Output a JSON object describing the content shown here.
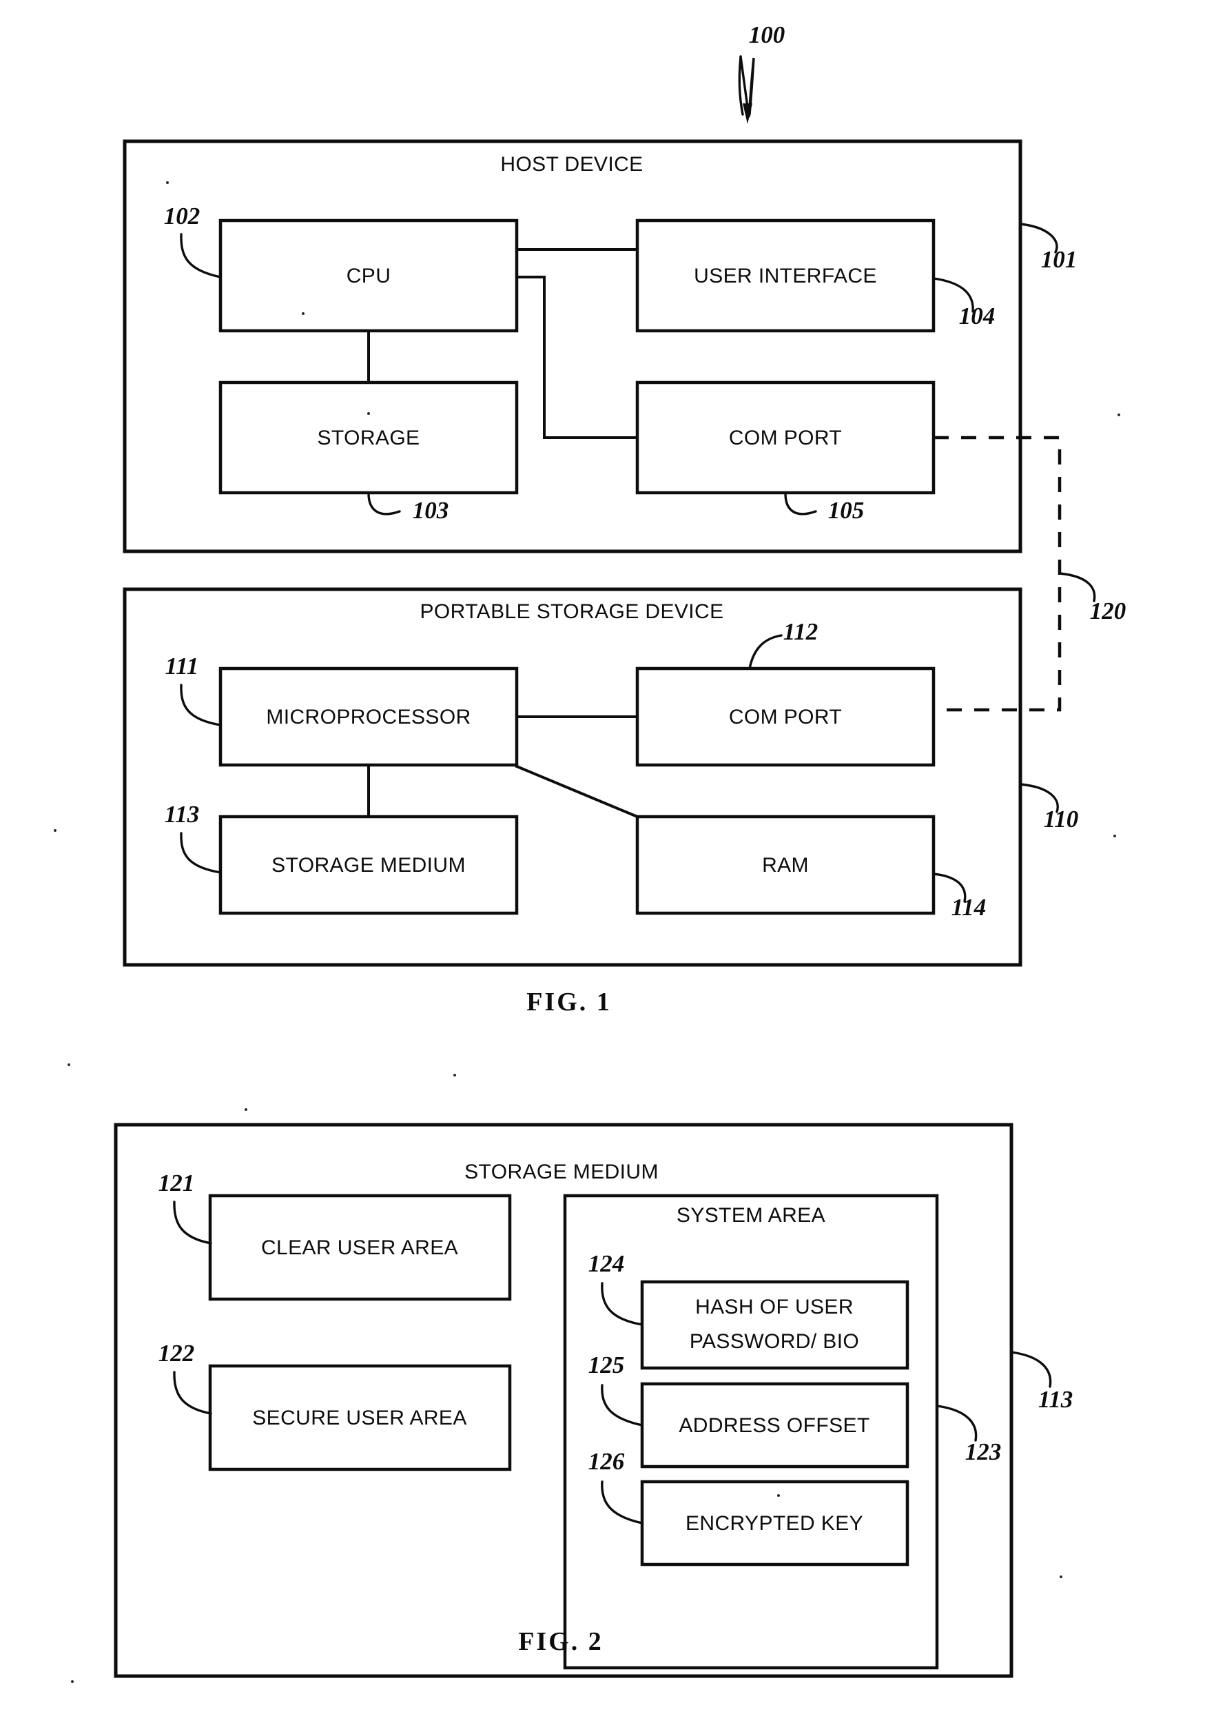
{
  "document": {
    "type": "patent-drawing-sheet",
    "figures": [
      {
        "id": "fig1",
        "caption": "FIG. 1",
        "system_ref": "100",
        "link_ref": "120",
        "containers": [
          {
            "title": "HOST DEVICE",
            "ref": "101",
            "blocks": [
              {
                "label": "CPU",
                "ref": "102"
              },
              {
                "label": "USER INTERFACE",
                "ref": "104"
              },
              {
                "label": "STORAGE",
                "ref": "103"
              },
              {
                "label": "COM PORT",
                "ref": "105"
              }
            ]
          },
          {
            "title": "PORTABLE STORAGE DEVICE",
            "ref": "110",
            "blocks": [
              {
                "label": "MICROPROCESSOR",
                "ref": "111"
              },
              {
                "label": "COM PORT",
                "ref": "112"
              },
              {
                "label": "STORAGE MEDIUM",
                "ref": "113"
              },
              {
                "label": "RAM",
                "ref": "114"
              }
            ]
          }
        ]
      },
      {
        "id": "fig2",
        "caption": "FIG. 2",
        "containers": [
          {
            "title": "STORAGE MEDIUM",
            "ref": "113",
            "blocks": [
              {
                "label": "CLEAR USER AREA",
                "ref": "121"
              },
              {
                "label": "SECURE USER AREA",
                "ref": "122"
              }
            ],
            "subcontainers": [
              {
                "title": "SYSTEM AREA",
                "ref": "123",
                "blocks": [
                  {
                    "label_line1": "HASH OF USER",
                    "label_line2": "PASSWORD/ BIO",
                    "ref": "124"
                  },
                  {
                    "label": "ADDRESS OFFSET",
                    "ref": "125"
                  },
                  {
                    "label": "ENCRYPTED KEY",
                    "ref": "126"
                  }
                ]
              }
            ]
          }
        ]
      }
    ]
  },
  "fig1": {
    "system_ref": "100",
    "link_ref": "120",
    "host": {
      "title": "HOST DEVICE",
      "ref": "101",
      "cpu": {
        "label": "CPU",
        "ref": "102"
      },
      "ui": {
        "label": "USER INTERFACE",
        "ref": "104"
      },
      "storage": {
        "label": "STORAGE",
        "ref": "103"
      },
      "comport": {
        "label": "COM PORT",
        "ref": "105"
      }
    },
    "portable": {
      "title": "PORTABLE STORAGE DEVICE",
      "ref": "110",
      "micro": {
        "label": "MICROPROCESSOR",
        "ref": "111"
      },
      "comport": {
        "label": "COM PORT",
        "ref": "112"
      },
      "medium": {
        "label": "STORAGE MEDIUM",
        "ref": "113"
      },
      "ram": {
        "label": "RAM",
        "ref": "114"
      }
    },
    "caption": "FIG. 1"
  },
  "fig2": {
    "medium": {
      "title": "STORAGE MEDIUM",
      "ref": "113",
      "clear": {
        "label": "CLEAR USER AREA",
        "ref": "121"
      },
      "secure": {
        "label": "SECURE USER AREA",
        "ref": "122"
      },
      "system": {
        "title": "SYSTEM AREA",
        "ref": "123",
        "hash": {
          "line1": "HASH OF USER",
          "line2": "PASSWORD/ BIO",
          "ref": "124"
        },
        "offset": {
          "label": "ADDRESS OFFSET",
          "ref": "125"
        },
        "key": {
          "label": "ENCRYPTED KEY",
          "ref": "126"
        }
      }
    },
    "caption": "FIG. 2"
  },
  "colors": {
    "ink": "#0d0d0d",
    "paper": "#ffffff"
  }
}
